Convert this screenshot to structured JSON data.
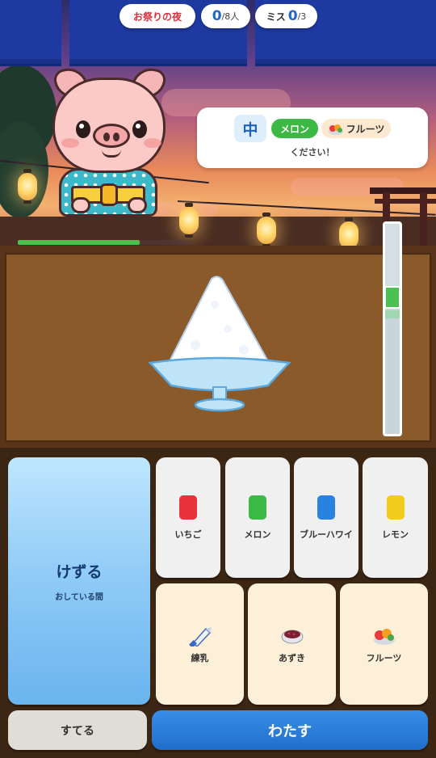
{
  "hud": {
    "title": "お祭りの夜",
    "served_count": "0",
    "served_total": "/8人",
    "miss_label": "ミス",
    "miss_count": "0",
    "miss_total": "/3"
  },
  "customer": {
    "patience_fraction": 0.7
  },
  "order": {
    "size": "中",
    "flavor": "メロン",
    "topping": "フルーツ",
    "request_text": "ください！"
  },
  "shave_gauge": {
    "level_fraction": 0.62
  },
  "controls": {
    "shave_label": "けずる",
    "shave_hint": "おしている間",
    "syrups": [
      {
        "label": "いちご",
        "color": "#e8323c"
      },
      {
        "label": "メロン",
        "color": "#3cb844"
      },
      {
        "label": "ブルーハワイ",
        "color": "#2a82e0"
      },
      {
        "label": "レモン",
        "color": "#f2cc1a"
      }
    ],
    "toppings": [
      {
        "label": "練乳",
        "icon": "condensed-milk-tube-icon"
      },
      {
        "label": "あずき",
        "icon": "azuki-bowl-icon"
      },
      {
        "label": "フルーツ",
        "icon": "fruit-plate-icon"
      }
    ],
    "discard_label": "すてる",
    "serve_label": "わたす"
  }
}
